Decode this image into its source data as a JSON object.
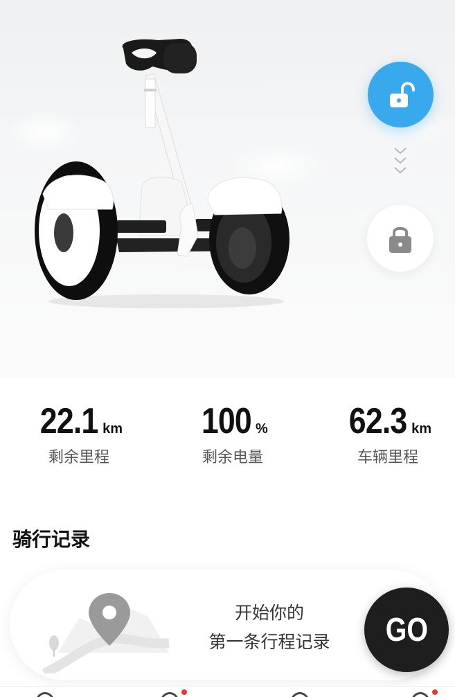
{
  "hero": {
    "device_image": "self-balancing-scooter",
    "unlock_button": {
      "icon": "unlock-icon",
      "color": "#39a9ee"
    },
    "swipe_hint": {
      "icon": "chevron-down-icon"
    },
    "lock_button": {
      "icon": "lock-icon"
    }
  },
  "stats": [
    {
      "value": "22.1",
      "unit": "km",
      "label": "剩余里程"
    },
    {
      "value": "100",
      "unit": "%",
      "label": "剩余电量"
    },
    {
      "value": "62.3",
      "unit": "km",
      "label": "车辆里程"
    }
  ],
  "ride_records": {
    "title": "骑行记录",
    "empty_line1": "开始你的",
    "empty_line2": "第一条行程记录",
    "go_label": "GO"
  },
  "colors": {
    "accent": "#39a9ee",
    "go_button": "#1e1e1e",
    "badge": "#e53935"
  }
}
